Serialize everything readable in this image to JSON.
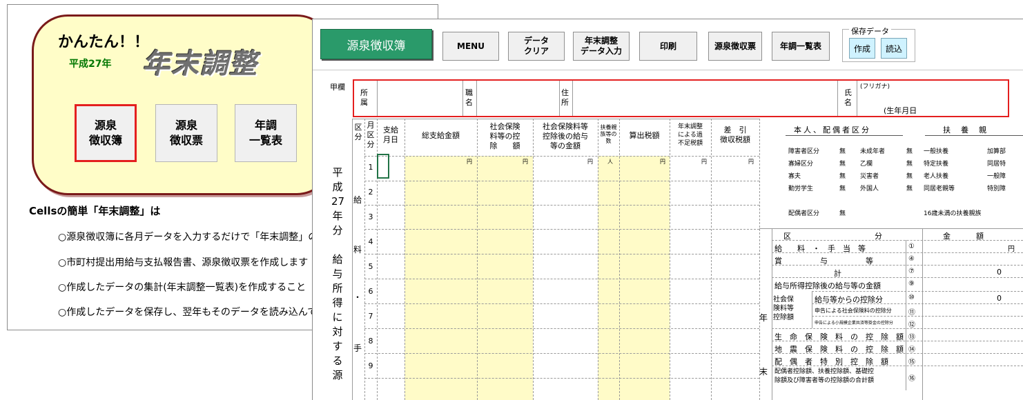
{
  "back": {
    "headline": "かんたん！！",
    "era": "平成27年",
    "logo": "年末調整",
    "buttons": [
      "源泉\n徴収簿",
      "源泉\n徴収票",
      "年調\n一覧表"
    ],
    "desc_title": "Cellsの簡単「年末調整」は",
    "desc": [
      "○源泉徴収簿に各月データを入力するだけで「年末調整」の",
      "○市町村提出用給与支払報告書、源泉徴収票を作成します",
      "○作成したデータの集計(年末調整一覧表)を作成すること",
      "○作成したデータを保存し、翌年もそのデータを読み込んで"
    ]
  },
  "toolbar": {
    "title": "源泉徴収簿",
    "menu": "MENU",
    "clear": "データ\nクリア",
    "yearend_input": "年末調整\nデータ入力",
    "print": "印刷",
    "withholding_slip": "源泉徴収票",
    "yearend_list": "年調一覧表",
    "save_group": "保存データ",
    "create": "作成",
    "read": "読込"
  },
  "header": {
    "kouran": "甲欄",
    "dept": "所\n属",
    "job": "職\n名",
    "address": "住\n所",
    "name": "氏\n名",
    "furigana": "(フリガナ)",
    "birth": "(生年月日"
  },
  "table": {
    "col_kubun": "区\n分",
    "col_month": "月\n区\n分",
    "col_payday": "支給\n月日",
    "col_total": "総支給金額",
    "col_social": "社会保険\n料等の控\n除　　額",
    "col_after": "社会保険料等\n控除後の給与\n等の金額",
    "col_dependents": "扶養親\n族等の\n数",
    "col_tax": "算出税額",
    "col_adjust": "年末調整\nによる過\n不足税額",
    "col_withheld": "差　引\n徴収税額",
    "unit_yen": "円",
    "unit_person": "人",
    "row_numbers": [
      "1",
      "2",
      "3",
      "4",
      "5",
      "6",
      "7",
      "8",
      "9"
    ],
    "side_kyu": "給",
    "side_ryo": "料",
    "side_dot": "・",
    "side_te": "手",
    "vertical_title": "平\n成\n27\n年\n分\n\n給\n与\n所\n得\n に\n対\nす\nる\n源"
  },
  "right": {
    "title1": "本人、配偶者区分",
    "title2": "扶　養　親",
    "rows": [
      [
        "障害者区分",
        "無",
        "未成年者",
        "無",
        "一般扶養",
        "加算部"
      ],
      [
        "寡婦区分",
        "無",
        "乙欄",
        "無",
        "特定扶養",
        "同居特"
      ],
      [
        "寡夫",
        "無",
        "災害者",
        "無",
        "老人扶養",
        "一般障"
      ],
      [
        "勤労学生",
        "無",
        "外国人",
        "無",
        "同居老親等",
        "特別障"
      ]
    ],
    "spouse_label": "配偶者区分",
    "spouse_value": "無",
    "under16": "16歳未満の扶養親族",
    "year_nen": "年",
    "year_matsu": "末",
    "adj_head_kubun": "区　　　　　　　　　　分",
    "adj_head_amount": "金　　　額",
    "adj": [
      {
        "label": "給　　料　・　手　当　等",
        "num": "①",
        "val": "円"
      },
      {
        "label": "賞　　　　　与　　　　　等",
        "num": "④",
        "val": ""
      },
      {
        "label": "計",
        "num": "⑦",
        "val": "0"
      },
      {
        "label": "給与所得控除後の給与等の金額",
        "num": "⑨",
        "val": ""
      },
      {
        "label": "給与等からの控除分",
        "num": "⑩",
        "val": "0"
      },
      {
        "label": "申告による社会保険料の控除分",
        "num": "⑪",
        "val": ""
      },
      {
        "label": "申告による小規模企業共済等掛金の控除分",
        "num": "⑫",
        "val": ""
      },
      {
        "label": "生　命　保　険　料　の　控　除　額",
        "num": "⑬",
        "val": ""
      },
      {
        "label": "地　震　保　険　料　の　控　除　額",
        "num": "⑭",
        "val": ""
      },
      {
        "label": "配　偶　者　特　別　控　除　額",
        "num": "⑮",
        "val": ""
      },
      {
        "label": "配偶者控除額、扶養控除額、基礎控\n除額及び障害者等の控除額の合計額",
        "num": "⑯",
        "val": ""
      }
    ],
    "social_group": "社会保\n険料等\n控除額"
  }
}
